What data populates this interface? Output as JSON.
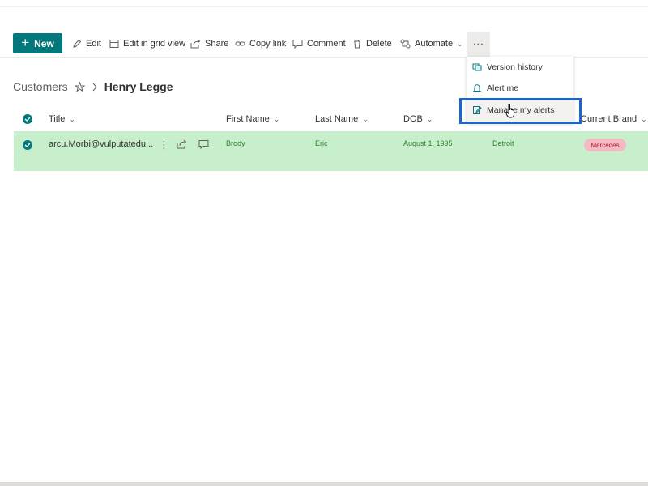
{
  "toolbar": {
    "new_label": "New",
    "edit_label": "Edit",
    "grid_label": "Edit in grid view",
    "share_label": "Share",
    "copylink_label": "Copy link",
    "comment_label": "Comment",
    "delete_label": "Delete",
    "automate_label": "Automate",
    "more_label": "⋯"
  },
  "breadcrumb": {
    "root": "Customers",
    "current": "Henry Legge"
  },
  "columns": {
    "title": "Title",
    "first_name": "First Name",
    "last_name": "Last Name",
    "dob": "DOB",
    "current_brand": "Current Brand"
  },
  "row": {
    "title": "arcu.Morbi@vulputatedu...",
    "first_name": "Brody",
    "last_name": "Eric",
    "dob": "August 1, 1995",
    "city": "Detroit",
    "brand": "Mercedes"
  },
  "menu": {
    "items": [
      {
        "label": "Version history"
      },
      {
        "label": "Alert me"
      },
      {
        "label": "Manage my alerts"
      }
    ]
  },
  "colors": {
    "accent": "#03787c",
    "selected_row": "#c8efcb",
    "highlight_box": "#1a66c9",
    "brand_pill": "#f4b9c3"
  }
}
